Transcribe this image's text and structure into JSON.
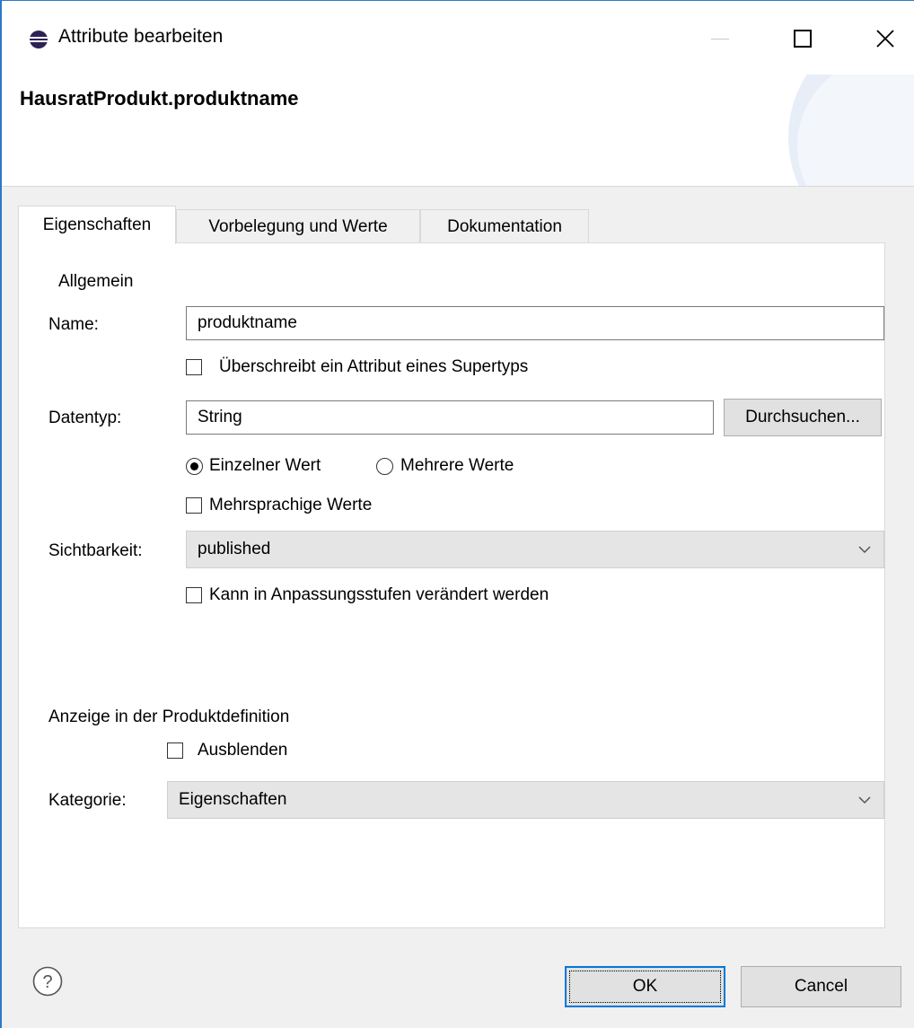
{
  "window": {
    "title": "Attribute bearbeiten",
    "icon": "eclipse-icon",
    "controls": [
      "minimize-icon",
      "maximize-icon",
      "close-icon"
    ]
  },
  "header": {
    "title": "HausratProdukt.produktname"
  },
  "tabs": [
    {
      "label": "Eigenschaften",
      "active": true
    },
    {
      "label": "Vorbelegung und Werte",
      "active": false
    },
    {
      "label": "Dokumentation",
      "active": false
    }
  ],
  "allgemein": {
    "section_label": "Allgemein",
    "name_label": "Name:",
    "name_value": "produktname",
    "override_label": "Überschreibt ein Attribut eines Supertyps",
    "override_checked": false,
    "datatype_label": "Datentyp:",
    "datatype_value": "String",
    "browse_label": "Durchsuchen...",
    "single_value_label": "Einzelner Wert",
    "single_value_selected": true,
    "multi_value_label": "Mehrere Werte",
    "multi_value_selected": false,
    "multilingual_label": "Mehrsprachige Werte",
    "multilingual_checked": false,
    "visibility_label": "Sichtbarkeit:",
    "visibility_value": "published",
    "changeable_label": "Kann in Anpassungsstufen verändert werden",
    "changeable_checked": false
  },
  "anzeige": {
    "section_label": "Anzeige in der Produktdefinition",
    "hide_label": "Ausblenden",
    "hide_checked": false,
    "category_label": "Kategorie:",
    "category_value": "Eigenschaften"
  },
  "footer": {
    "help_icon": "help-icon",
    "ok_label": "OK",
    "cancel_label": "Cancel"
  },
  "colors": {
    "accent": "#0078d7",
    "window_border": "#2b79c8"
  }
}
